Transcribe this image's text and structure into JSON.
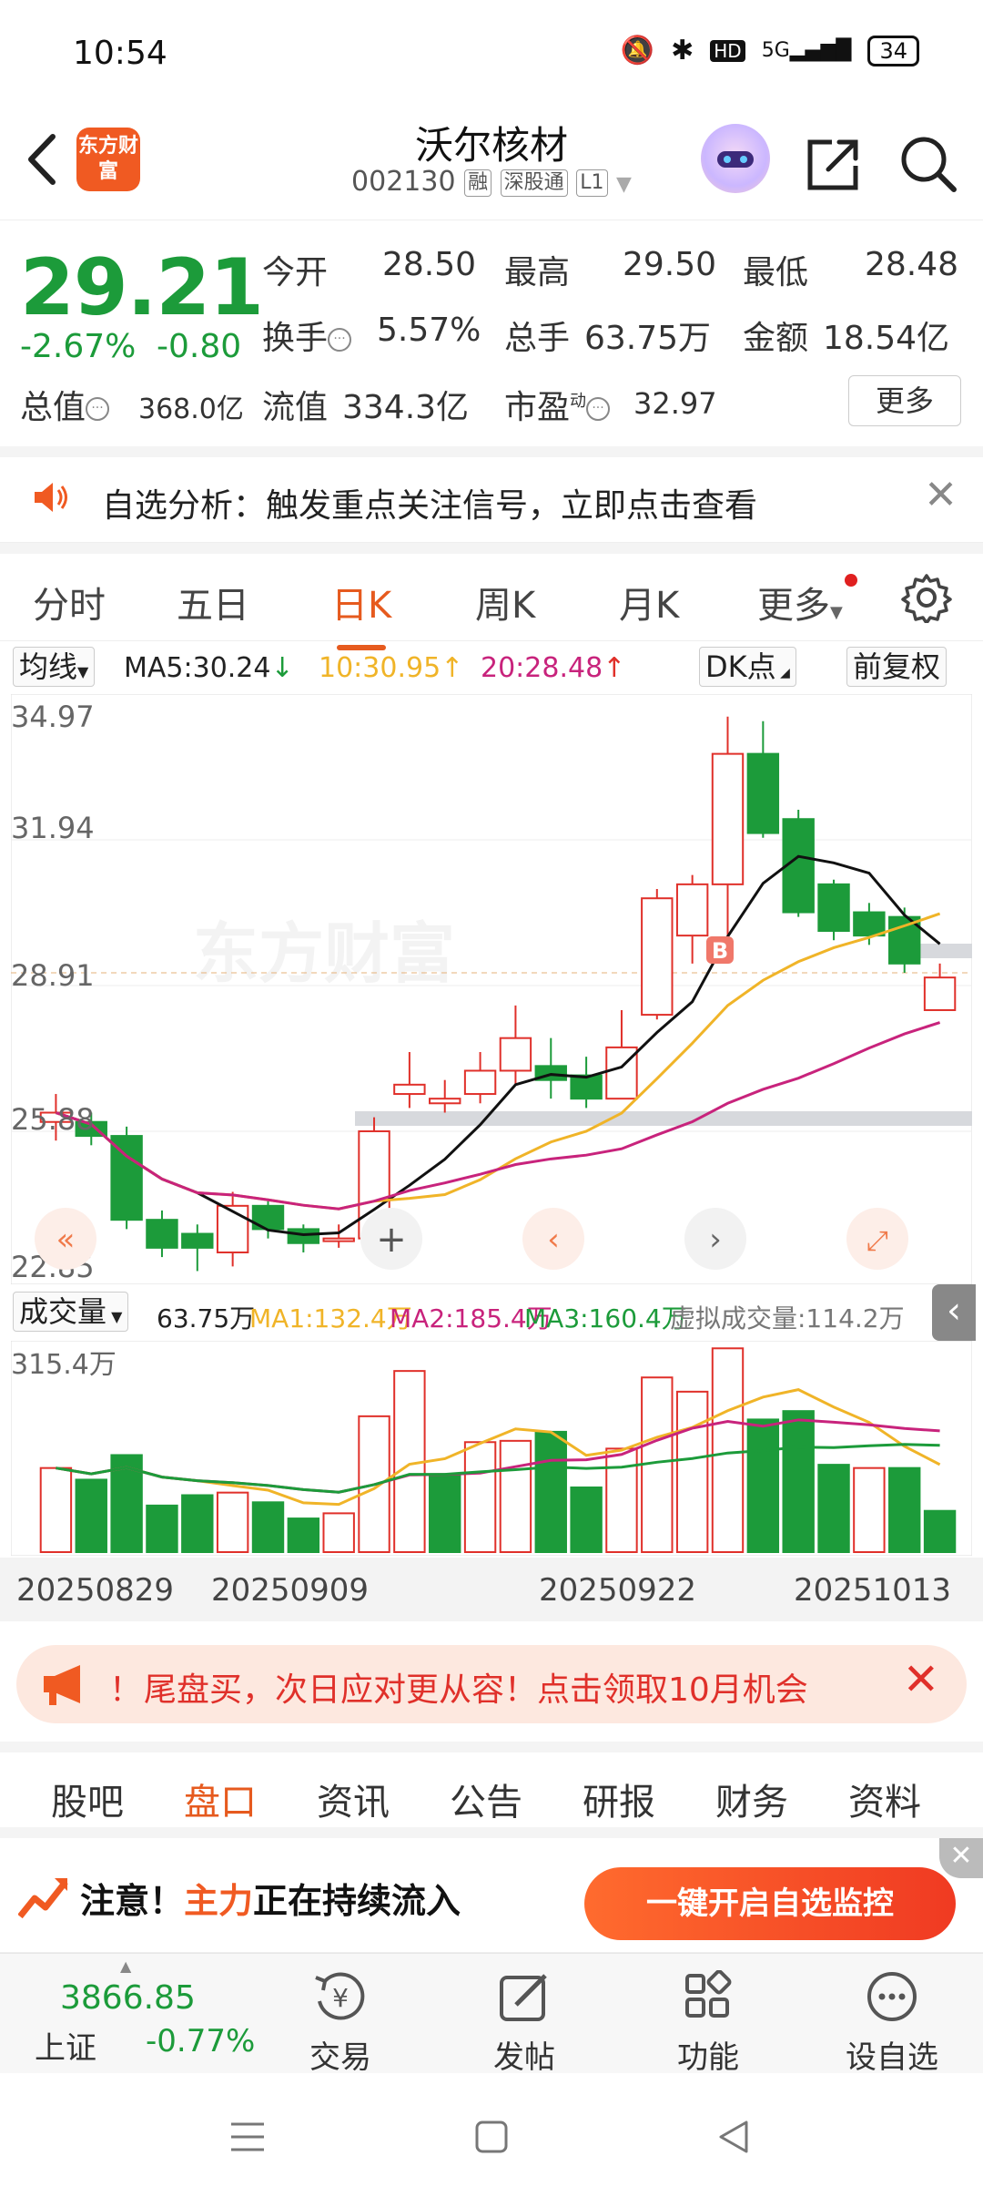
{
  "status": {
    "time": "10:54",
    "network": "5G",
    "battery": "34"
  },
  "header": {
    "title": "沃尔核材",
    "code": "002130",
    "tags": [
      "融",
      "深股通",
      "L1"
    ],
    "logo_text": "东方财富"
  },
  "quote": {
    "price": "29.21",
    "change_pct": "-2.67%",
    "change": "-0.80",
    "open_label": "今开",
    "open": "28.50",
    "high_label": "最高",
    "high": "29.50",
    "low_label": "最低",
    "low": "28.48",
    "turnover_label": "换手",
    "turnover": "5.57%",
    "volume_label": "总手",
    "volume": "63.75万",
    "amount_label": "金额",
    "amount": "18.54亿",
    "mktcap_label": "总值",
    "mktcap": "368.0亿",
    "float_label": "流值",
    "float": "334.3亿",
    "pe_label": "市盈",
    "pe_sup": "动",
    "pe": "32.97",
    "more": "更多"
  },
  "notice": {
    "text": "自选分析：触发重点关注信号，立即点击查看"
  },
  "ktabs": [
    "分时",
    "五日",
    "日K",
    "周K",
    "月K",
    "更多"
  ],
  "ma": {
    "label": "均线",
    "ma5": "MA5:30.24",
    "ma10": "10:30.95",
    "ma20": "20:28.48",
    "dk": "DK点",
    "fq": "前复权"
  },
  "kchart_labels": {
    "y_top": "34.97",
    "y_2": "31.94",
    "y_3": "28.91",
    "y_4": "25.88",
    "y_bottom": "22.85",
    "b_marker": "B",
    "watermark": "东方财富"
  },
  "vol": {
    "label": "成交量",
    "vol": "63.75万",
    "ma1": "MA1:132.4万",
    "ma2": "MA2:185.4万",
    "ma3": "MA3:160.4万",
    "virtual": "虚拟成交量:114.2万",
    "y_top": "315.4万"
  },
  "dates": [
    "20250829",
    "20250909",
    "20250922",
    "20251013"
  ],
  "promo": {
    "text": "尾盘买，次日应对更从容！点击领取10月机会",
    "lead": "！"
  },
  "btabs": [
    "股吧",
    "盘口",
    "资讯",
    "公告",
    "研报",
    "财务",
    "资料"
  ],
  "alert": {
    "text_a": "注意！",
    "text_b": "主力",
    "text_c": "正在持续流入",
    "button": "一键开启自选监控"
  },
  "toolbar": {
    "index_val": "3866.85",
    "index_name": "上证",
    "index_pct": "-0.77%",
    "items": [
      "交易",
      "发帖",
      "功能",
      "设自选"
    ]
  },
  "colors": {
    "up": "#e0302a",
    "down": "#1c9b3a",
    "accent": "#e65a1e",
    "ma5": "#111111",
    "ma10": "#f0b428",
    "ma20": "#c8237c"
  },
  "chart_data": {
    "type": "candlestick",
    "ylim": [
      22.85,
      34.97
    ],
    "y_ticks": [
      34.97,
      31.94,
      28.91,
      25.88,
      22.85
    ],
    "candles": [
      {
        "o": 26.1,
        "c": 26.3,
        "h": 26.7,
        "l": 25.7
      },
      {
        "o": 26.1,
        "c": 25.8,
        "h": 26.3,
        "l": 25.6
      },
      {
        "o": 25.8,
        "c": 24.0,
        "h": 26.0,
        "l": 23.8
      },
      {
        "o": 24.0,
        "c": 23.4,
        "h": 24.2,
        "l": 23.2
      },
      {
        "o": 23.7,
        "c": 23.4,
        "h": 23.9,
        "l": 22.9
      },
      {
        "o": 23.3,
        "c": 24.3,
        "h": 24.6,
        "l": 23.0
      },
      {
        "o": 24.3,
        "c": 23.8,
        "h": 24.4,
        "l": 23.6
      },
      {
        "o": 23.8,
        "c": 23.5,
        "h": 23.9,
        "l": 23.3
      },
      {
        "o": 23.6,
        "c": 23.6,
        "h": 23.9,
        "l": 23.4
      },
      {
        "o": 23.6,
        "c": 25.9,
        "h": 26.2,
        "l": 23.3
      },
      {
        "o": 26.7,
        "c": 26.9,
        "h": 27.6,
        "l": 26.4
      },
      {
        "o": 26.5,
        "c": 26.6,
        "h": 27.0,
        "l": 26.3
      },
      {
        "o": 26.7,
        "c": 27.2,
        "h": 27.6,
        "l": 26.5
      },
      {
        "o": 27.2,
        "c": 27.9,
        "h": 28.6,
        "l": 26.9
      },
      {
        "o": 27.3,
        "c": 27.0,
        "h": 27.9,
        "l": 26.6
      },
      {
        "o": 27.1,
        "c": 26.6,
        "h": 27.5,
        "l": 26.4
      },
      {
        "o": 26.6,
        "c": 27.7,
        "h": 28.5,
        "l": 26.6
      },
      {
        "o": 28.4,
        "c": 30.9,
        "h": 31.1,
        "l": 28.3
      },
      {
        "o": 30.1,
        "c": 31.2,
        "h": 31.4,
        "l": 29.5
      },
      {
        "o": 31.2,
        "c": 34.0,
        "h": 34.8,
        "l": 29.6
      },
      {
        "o": 34.0,
        "c": 32.3,
        "h": 34.7,
        "l": 32.2
      },
      {
        "o": 32.6,
        "c": 30.6,
        "h": 32.8,
        "l": 30.5
      },
      {
        "o": 31.2,
        "c": 30.2,
        "h": 31.3,
        "l": 30.0
      },
      {
        "o": 30.6,
        "c": 30.1,
        "h": 30.8,
        "l": 29.9
      },
      {
        "o": 30.5,
        "c": 29.5,
        "h": 30.7,
        "l": 29.3
      },
      {
        "o": 28.5,
        "c": 29.2,
        "h": 29.5,
        "l": 28.5
      }
    ],
    "volume": {
      "ylim": [
        0,
        315.4
      ],
      "values": [
        130,
        112,
        150,
        72,
        88,
        92,
        77,
        52,
        60,
        210,
        280,
        120,
        170,
        172,
        186,
        100,
        160,
        270,
        248,
        315,
        205,
        218,
        135,
        130,
        130,
        63.75
      ],
      "up": [
        true,
        false,
        false,
        false,
        false,
        true,
        false,
        false,
        true,
        true,
        true,
        false,
        true,
        true,
        false,
        false,
        true,
        true,
        true,
        true,
        false,
        false,
        false,
        true,
        false,
        false
      ]
    }
  }
}
